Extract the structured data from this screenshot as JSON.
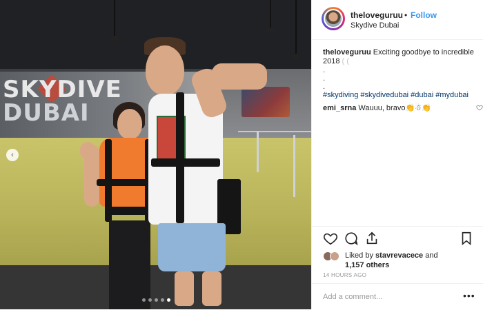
{
  "post": {
    "username": "theloveguruu",
    "follow_separator": "•",
    "follow_label": "Follow",
    "location": "Skydive Dubai",
    "caption_user": "theloveguruu",
    "caption_text": "Exciting goodbye to incredible 2018",
    "caption_faint": "⁠( (",
    "caption_dots": [
      ".",
      ".",
      "."
    ],
    "hashtags": "#skydiving #skydivedubai #dubai #mydubai",
    "comments": [
      {
        "user": "emi_srna",
        "text": "Wauuu, bravo👏☃👏"
      }
    ],
    "liked_by_prefix": "Liked by",
    "liked_by_user": "stavrevacece",
    "liked_by_and": "and",
    "liked_by_others": "1,157 others",
    "timestamp": "14 HOURS AGO",
    "comment_placeholder": "Add a comment...",
    "more_label": "•••"
  },
  "photo": {
    "sign_line1": "SKYDIVE",
    "sign_line2": "DUBAI",
    "carousel_count": 5,
    "carousel_active_index": 4,
    "prev_arrow": "‹"
  },
  "icons": {
    "like": "heart-icon",
    "comment": "comment-icon",
    "share": "share-icon",
    "save": "bookmark-icon",
    "comment_like": "heart-icon"
  },
  "colors": {
    "follow": "#3897f0",
    "hashtag": "#003569",
    "text": "#262626",
    "muted": "#999999"
  }
}
